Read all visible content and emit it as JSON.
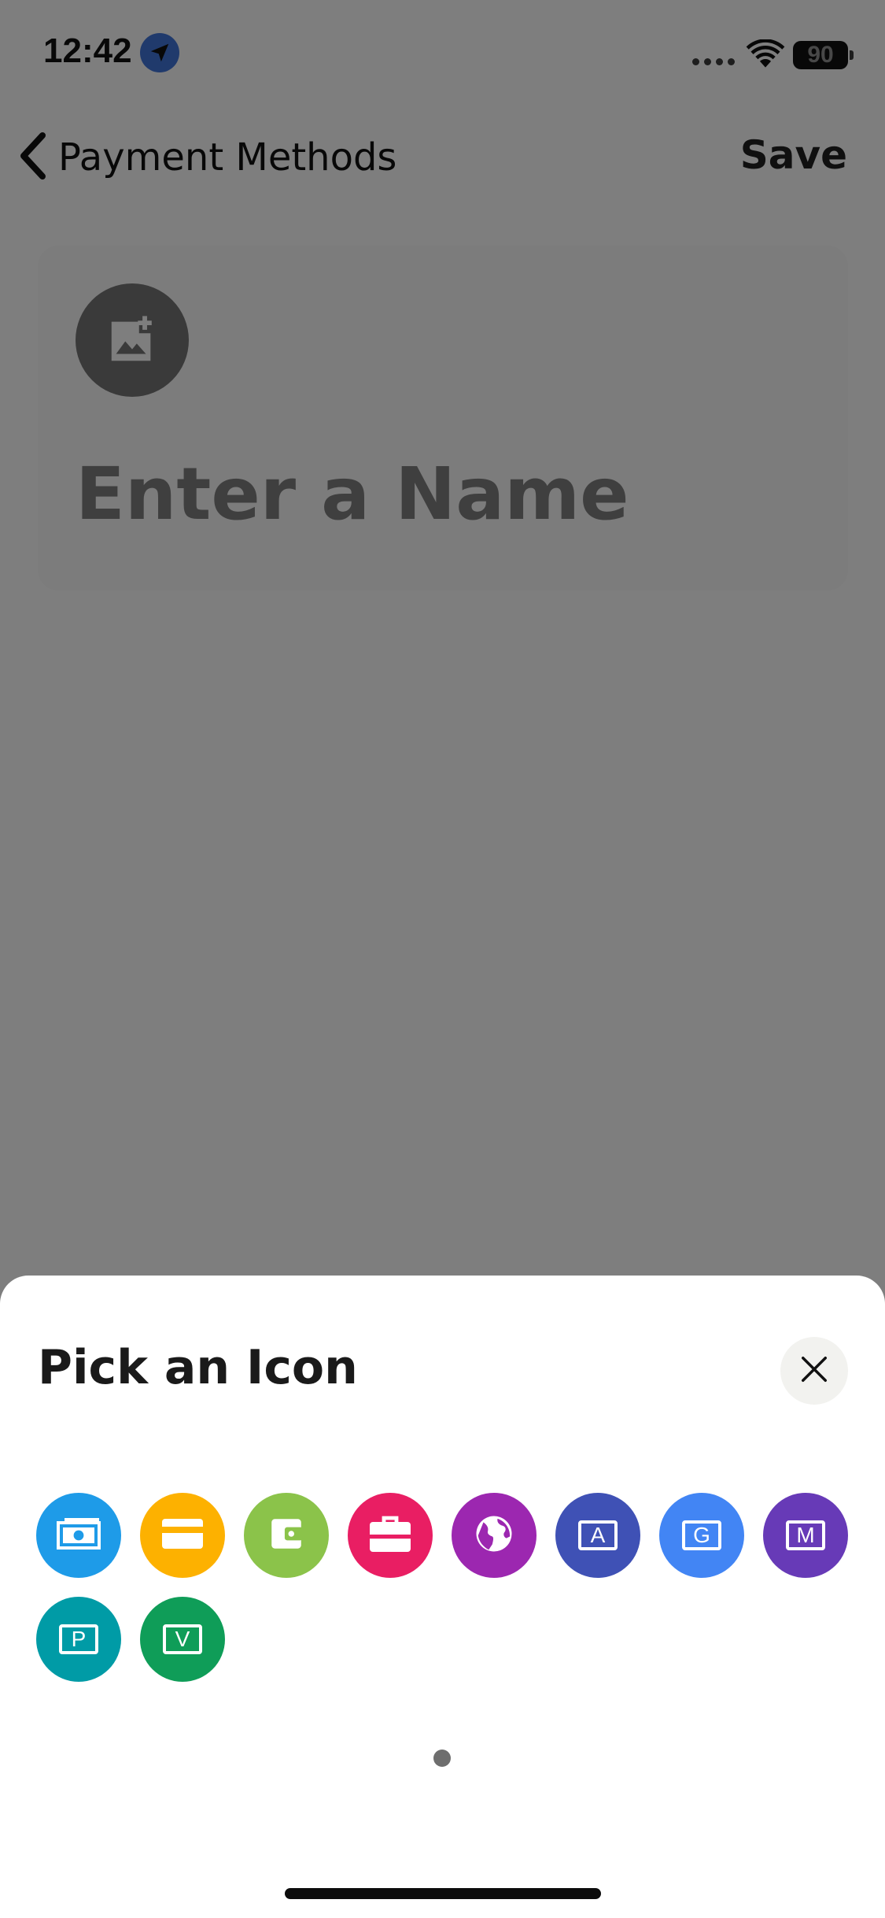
{
  "status_bar": {
    "time": "12:42",
    "battery": "90",
    "icons": [
      "location-arrow-icon",
      "signal-dots-icon",
      "wifi-icon",
      "battery-icon"
    ]
  },
  "nav": {
    "back_label": "Payment Methods",
    "save_label": "Save"
  },
  "card": {
    "image_icon": "add-image-icon",
    "name_placeholder": "Enter a Name"
  },
  "sheet": {
    "title": "Pick an Icon",
    "close_icon": "close-icon",
    "icons": [
      {
        "name": "cash-icon",
        "color": "#1e9be8"
      },
      {
        "name": "credit-card-icon",
        "color": "#fdb100"
      },
      {
        "name": "wallet-icon",
        "color": "#8bc34a"
      },
      {
        "name": "briefcase-icon",
        "color": "#e91e63"
      },
      {
        "name": "globe-icon",
        "color": "#9c27b0"
      },
      {
        "name": "letter-a-icon",
        "color": "#3f51b5",
        "letter": "A"
      },
      {
        "name": "letter-g-icon",
        "color": "#4285f4",
        "letter": "G"
      },
      {
        "name": "letter-m-icon",
        "color": "#673ab7",
        "letter": "M"
      },
      {
        "name": "letter-p-icon",
        "color": "#009ba6",
        "letter": "P"
      },
      {
        "name": "letter-v-icon",
        "color": "#0f9d58",
        "letter": "V"
      }
    ]
  }
}
